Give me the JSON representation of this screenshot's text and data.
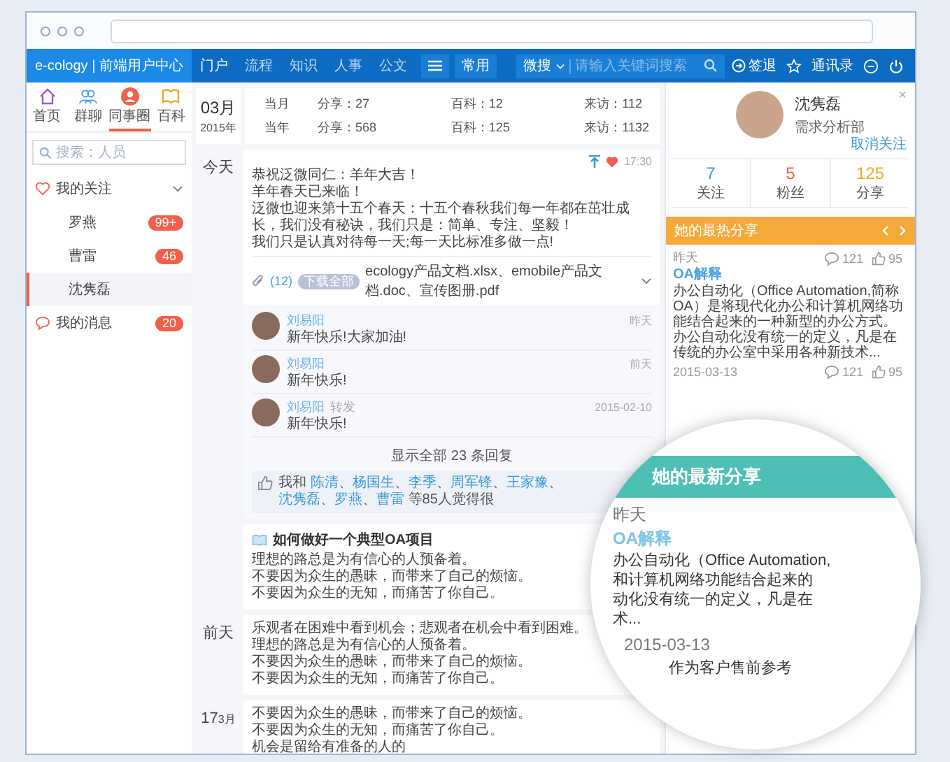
{
  "app": {
    "title": "e-cology | 前端用户中心"
  },
  "nav": [
    {
      "label": "门户",
      "selected": true
    },
    {
      "label": "流程",
      "selected": false
    },
    {
      "label": "知识",
      "selected": false
    },
    {
      "label": "人事",
      "selected": false
    },
    {
      "label": "公文",
      "selected": false
    }
  ],
  "common_button": "常用",
  "search": {
    "scope": "微搜",
    "placeholder": "请输入关键词搜索"
  },
  "header_links": {
    "sign_out": "签退",
    "contacts": "通讯录"
  },
  "sidebar": {
    "tabs": [
      {
        "kind": "home",
        "label": "首页",
        "selected": false
      },
      {
        "kind": "group",
        "label": "群聊",
        "selected": false
      },
      {
        "kind": "circle",
        "label": "同事圈",
        "selected": true
      },
      {
        "kind": "wiki",
        "label": "百科",
        "selected": false
      }
    ],
    "search": {
      "placeholder": "搜索：人员"
    },
    "groups": [
      {
        "kind": "follow",
        "label": "我的关注",
        "expanded": true,
        "children": [
          {
            "label": "罗燕",
            "badge": "99+",
            "selected": false
          },
          {
            "label": "曹雷",
            "badge": "46",
            "selected": false
          },
          {
            "label": "沈隽磊",
            "selected": true
          }
        ]
      },
      {
        "kind": "messages",
        "label": "我的消息",
        "badge": "20"
      }
    ]
  },
  "stats": {
    "month": "03月",
    "year": "2015年",
    "rows": [
      {
        "label": "当月",
        "cells": [
          "分享：27",
          "百科：12",
          "来访：112"
        ]
      },
      {
        "label": "当年",
        "cells": [
          "分享：568",
          "百科：125",
          "来访：1132"
        ]
      }
    ]
  },
  "feed": [
    {
      "day": "今天",
      "cards": [
        {
          "kind": "post",
          "pinned": true,
          "liked": true,
          "time": "17:30",
          "lines": [
            "恭祝泛微同仁：羊年大吉！",
            "羊年春天已来临！",
            "泛微也迎来第十五个春天：十五个春秋我们每一年都在茁壮成长，我们没有秘诀，我们只是：简单、专注、坚毅！",
            "我们只是认真对待每一天;每一天比标准多做一点!"
          ],
          "attachments": {
            "count": "(12)",
            "button": "下载全部",
            "files": "ecology产品文档.xlsx、emobile产品文档.doc、宣传图册.pdf"
          },
          "replies": [
            {
              "name": "刘易阳",
              "text": "新年快乐!大家加油!",
              "time": "昨天"
            },
            {
              "name": "刘易阳",
              "text": "新年快乐!",
              "time": "前天"
            },
            {
              "name": "刘易阳",
              "tag": "转发",
              "text": "新年快乐!",
              "time": "2015-02-10"
            }
          ],
          "show_all": "显示全部 23 条回复",
          "likes": {
            "prefix": "我和",
            "names": [
              "陈清",
              "杨国生",
              "李季",
              "周军锋",
              "王家豫",
              "沈隽磊",
              "罗燕",
              "曹雷"
            ],
            "separator": "、",
            "suffix": "等85人觉得很"
          }
        },
        {
          "kind": "article",
          "title": "如何做好一个典型OA项目",
          "lines": [
            "理想的路总是为有信心的人预备着。",
            "不要因为众生的愚昧，而带来了自己的烦恼。",
            "不要因为众生的无知，而痛苦了你自己。"
          ]
        }
      ]
    },
    {
      "day": "前天",
      "cards": [
        {
          "kind": "note",
          "lines": [
            "乐观者在困难中看到机会；悲观者在机会中看到困难。",
            "理想的路总是为有信心的人预备着。",
            "不要因为众生的愚昧，而带来了自己的烦恼。",
            "不要因为众生的无知，而痛苦了你自己。"
          ]
        }
      ]
    },
    {
      "day": "17",
      "day_suffix": "3月",
      "cards": [
        {
          "kind": "note",
          "lines": [
            "不要因为众生的愚昧，而带来了自己的烦恼。",
            "不要因为众生的无知，而痛苦了你自己。",
            "机会是留给有准备的人的"
          ]
        }
      ]
    }
  ],
  "profile": {
    "name": "沈隽磊",
    "department": "需求分析部",
    "close": "×",
    "unfollow": "取消关注",
    "counts": [
      {
        "value": "7",
        "label": "关注",
        "color": "#3a9ad9"
      },
      {
        "value": "5",
        "label": "粉丝",
        "color": "#f0604a"
      },
      {
        "value": "125",
        "label": "分享",
        "color": "#f5a623"
      }
    ]
  },
  "hot_shares": {
    "title": "她的最热分享",
    "items": [
      {
        "date": "昨天",
        "comments": "121",
        "likes": "95",
        "title": "OA解释",
        "text": "办公自动化（Office Automation,简称OA）是将现代化办公和计算机网络功能结合起来的一种新型的办公方式。办公自动化没有统一的定义，凡是在传统的办公室中采用各种新技术..."
      },
      {
        "date": "2015-03-13",
        "comments": "121",
        "likes": "95"
      }
    ]
  },
  "magnifier": {
    "title": "她的最新分享",
    "date": "昨天",
    "item_title": "OA解释",
    "lines": [
      "办公自动化（Office Automation,",
      "和计算机网络功能结合起来的",
      "动化没有统一的定义，凡是在",
      "术..."
    ],
    "date2": "2015-03-13",
    "line2": "作为客户售前参考"
  }
}
